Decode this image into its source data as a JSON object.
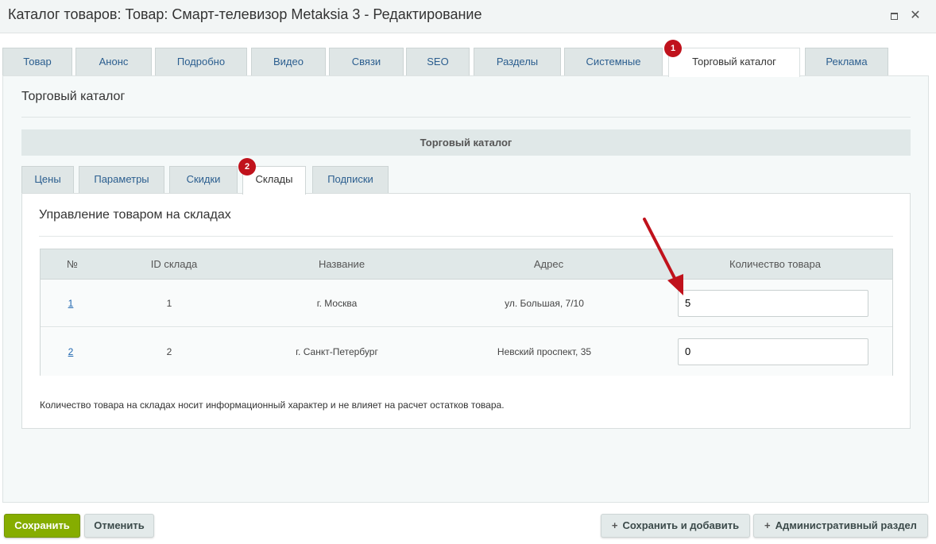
{
  "window": {
    "title": "Каталог товаров: Товар: Смарт-телевизор Metaksia 3 - Редактирование",
    "maximize_icon": "maximize-icon",
    "close_glyph": "✕"
  },
  "main_tabs": [
    {
      "label": "Товар"
    },
    {
      "label": "Анонс"
    },
    {
      "label": "Подробно"
    },
    {
      "label": "Видео"
    },
    {
      "label": "Связи"
    },
    {
      "label": "SEO"
    },
    {
      "label": "Разделы"
    },
    {
      "label": "Системные"
    },
    {
      "label": "Торговый каталог"
    },
    {
      "label": "Реклама"
    }
  ],
  "panel": {
    "title": "Торговый каталог",
    "section_header": "Торговый каталог"
  },
  "sub_tabs": [
    {
      "label": "Цены"
    },
    {
      "label": "Параметры"
    },
    {
      "label": "Скидки"
    },
    {
      "label": "Склады"
    },
    {
      "label": "Подписки"
    }
  ],
  "annotations": {
    "badge1": "1",
    "badge2": "2",
    "badge_color": "#c0121c",
    "arrow_color": "#c0121c"
  },
  "warehouses": {
    "title": "Управление товаром на складах",
    "columns": [
      "№",
      "ID склада",
      "Название",
      "Адрес",
      "Количество товара"
    ],
    "rows": [
      {
        "num": "1",
        "id": "1",
        "name": "г. Москва",
        "address": "ул. Большая, 7/10",
        "qty": "5"
      },
      {
        "num": "2",
        "id": "2",
        "name": "г. Санкт-Петербург",
        "address": "Невский проспект, 35",
        "qty": "0"
      }
    ],
    "note": "Количество товара на складах носит информационный характер и не влияет на расчет остатков товара."
  },
  "footer": {
    "save": "Сохранить",
    "cancel": "Отменить",
    "save_add": "Сохранить и добавить",
    "admin": "Административный раздел",
    "save_color": "#86ad00"
  }
}
